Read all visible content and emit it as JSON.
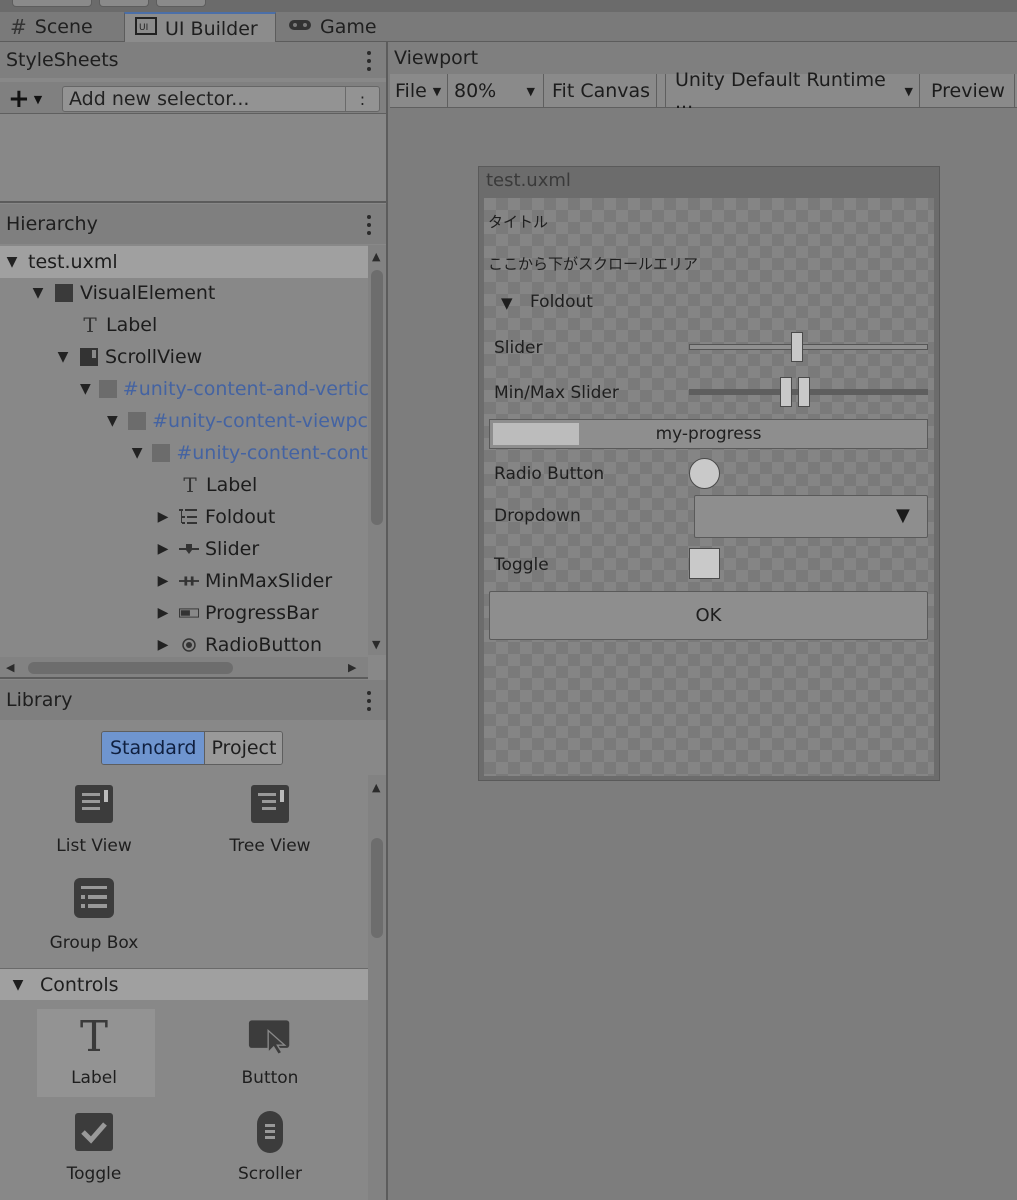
{
  "tabs": [
    {
      "label": "Scene",
      "icon": "hash-icon"
    },
    {
      "label": "UI Builder",
      "icon": "ui-builder-icon"
    },
    {
      "label": "Game",
      "icon": "gamepad-icon"
    }
  ],
  "stylesheets": {
    "title": "StyleSheets",
    "add_label": "+",
    "selector_placeholder": "Add new selector...",
    "colon_label": ":"
  },
  "hierarchy": {
    "title": "Hierarchy",
    "items": [
      {
        "label": "test.uxml",
        "expanded": true,
        "selected": true
      },
      {
        "label": "VisualElement",
        "expanded": true
      },
      {
        "label": "Label"
      },
      {
        "label": "ScrollView",
        "expanded": true
      },
      {
        "label": "#unity-content-and-vertic",
        "expanded": true,
        "style": "blue"
      },
      {
        "label": "#unity-content-viewpc",
        "expanded": true,
        "style": "blue"
      },
      {
        "label": "#unity-content-cont",
        "expanded": true,
        "style": "blue"
      },
      {
        "label": "Label"
      },
      {
        "label": "Foldout",
        "expanded": false
      },
      {
        "label": "Slider",
        "expanded": false
      },
      {
        "label": "MinMaxSlider",
        "expanded": false
      },
      {
        "label": "ProgressBar",
        "expanded": false
      },
      {
        "label": "RadioButton",
        "expanded": false
      }
    ]
  },
  "library": {
    "title": "Library",
    "tabs": [
      "Standard",
      "Project"
    ],
    "active_tab": "Standard",
    "containers": [
      {
        "label": "List View",
        "icon": "list-view-icon"
      },
      {
        "label": "Tree View",
        "icon": "tree-view-icon"
      },
      {
        "label": "Group Box",
        "icon": "group-box-icon"
      }
    ],
    "controls_header": "Controls",
    "controls": [
      {
        "label": "Label",
        "icon": "text-t-icon"
      },
      {
        "label": "Button",
        "icon": "button-cursor-icon"
      },
      {
        "label": "Toggle",
        "icon": "checkbox-icon"
      },
      {
        "label": "Scroller",
        "icon": "scroller-icon"
      }
    ]
  },
  "viewport": {
    "title": "Viewport",
    "toolbar": {
      "file": "File",
      "zoom": "80%",
      "fit": "Fit Canvas",
      "theme": "Unity Default Runtime ...",
      "preview": "Preview"
    },
    "canvas": {
      "title": "test.uxml",
      "label_title": "タイトル",
      "label_scroll": "ここから下がスクロールエリア",
      "foldout": "Foldout",
      "slider_label": "Slider",
      "slider_value": 0.45,
      "minmax_label": "Min/Max Slider",
      "minmax_low": 0.4,
      "minmax_high": 0.48,
      "progress_title": "my-progress",
      "progress_value": 0.2,
      "radio_label": "Radio Button",
      "dropdown_label": "Dropdown",
      "toggle_label": "Toggle",
      "ok_button": "OK"
    }
  }
}
